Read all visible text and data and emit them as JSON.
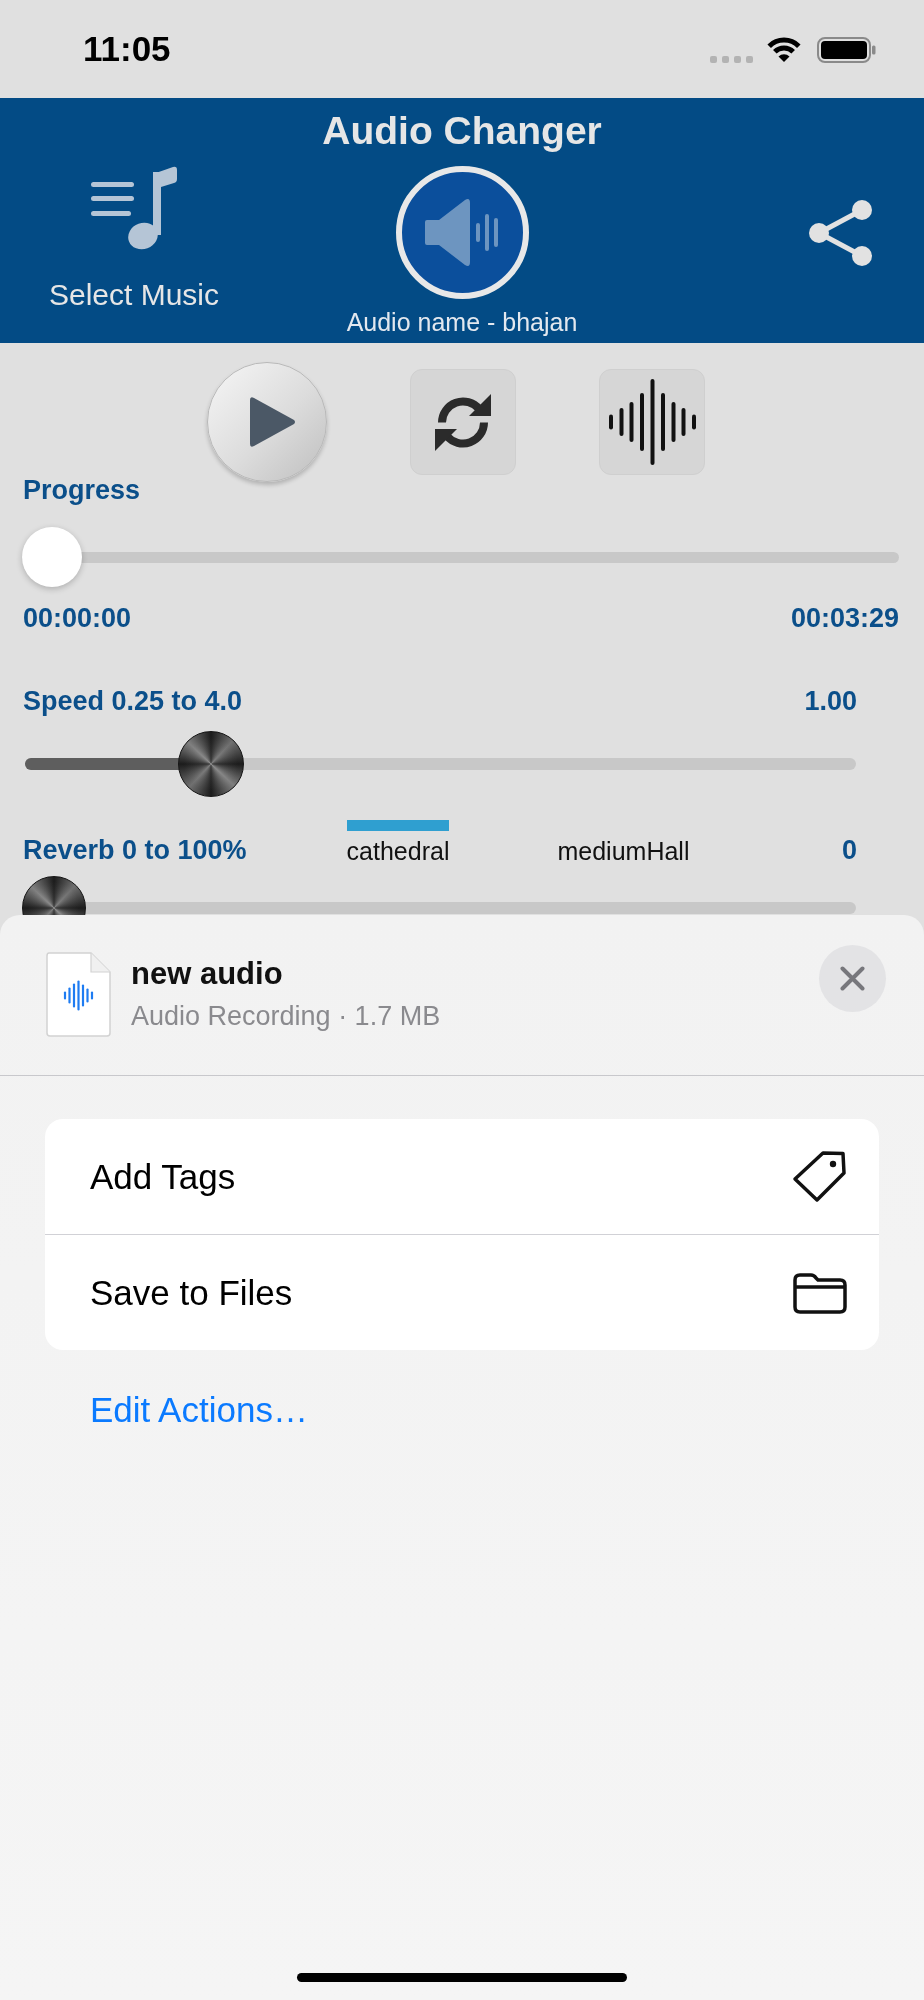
{
  "status_bar": {
    "time": "11:05"
  },
  "header": {
    "title": "Audio Changer",
    "select_music": "Select Music",
    "audio_name": "Audio name - bhajan"
  },
  "progress": {
    "label": "Progress",
    "level": 0,
    "elapsed": "00:00:00",
    "total": "00:03:29"
  },
  "speed": {
    "label": "Speed 0.25 to 4.0",
    "value": "1.00",
    "level": 0.2
  },
  "reverb": {
    "label": "Reverb 0 to 100%",
    "presets": [
      {
        "label": "cathedral",
        "selected": true
      },
      {
        "label": "mediumHall",
        "selected": false
      }
    ],
    "value": "0",
    "level": 0
  },
  "share_sheet": {
    "file": {
      "name": "new audio",
      "details": "Audio Recording · 1.7 MB"
    },
    "actions": [
      {
        "label": "Add Tags",
        "kind": "tag"
      },
      {
        "label": "Save to Files",
        "kind": "folder"
      }
    ],
    "edit_actions": "Edit Actions…"
  }
}
